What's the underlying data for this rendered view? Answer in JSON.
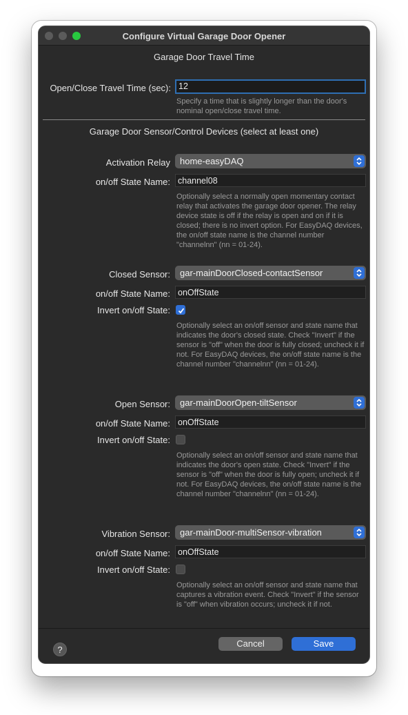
{
  "window": {
    "title": "Configure Virtual Garage Door Opener"
  },
  "travel": {
    "section_title": "Garage Door Travel Time",
    "label": "Open/Close Travel Time (sec):",
    "value": "12",
    "help": "Specify a time that is slightly longer than the door's nominal open/close travel time."
  },
  "devices": {
    "section_title": "Garage Door Sensor/Control Devices (select at least one)"
  },
  "relay": {
    "label": "Activation Relay",
    "device": "home-easyDAQ",
    "state_label": "on/off State Name:",
    "state_value": "channel08",
    "help": "Optionally select a normally open momentary contact relay that activates the garage door opener. The relay device state is off if the relay is open and on if it is closed; there is no invert option.  For EasyDAQ devices, the on/off state name is the channel number \"channelnn\" (nn = 01-24)."
  },
  "closed": {
    "label": "Closed Sensor:",
    "device": "gar-mainDoorClosed-contactSensor",
    "state_label": "on/off State Name:",
    "state_value": "onOffState",
    "invert_label": "Invert on/off State:",
    "invert_checked": true,
    "help": "Optionally select an on/off sensor and state name that indicates the door's closed state.  Check \"Invert\" if the sensor is \"off\" when the door is fully closed; uncheck it if not.  For EasyDAQ devices, the on/off state name is the channel number \"channelnn\" (nn = 01-24)."
  },
  "open": {
    "label": "Open Sensor:",
    "device": "gar-mainDoorOpen-tiltSensor",
    "state_label": "on/off State Name:",
    "state_value": "onOffState",
    "invert_label": "Invert on/off State:",
    "invert_checked": false,
    "help": "Optionally select an on/off sensor and state name that indicates the door's open state.  Check \"Invert\" if the sensor is \"off\" when the door is fully open; uncheck it if not.  For EasyDAQ devices, the on/off state name is the channel number \"channelnn\" (nn = 01-24)."
  },
  "vibration": {
    "label": "Vibration Sensor:",
    "device": "gar-mainDoor-multiSensor-vibration",
    "state_label": "on/off State Name:",
    "state_value": "onOffState",
    "invert_label": "Invert on/off State:",
    "invert_checked": false,
    "help": "Optionally select an on/off sensor and state name that captures a vibration event.  Check \"Invert\" if the sensor is \"off\" when vibration occurs; uncheck it if not."
  },
  "footer": {
    "help_symbol": "?",
    "cancel_label": "Cancel",
    "save_label": "Save"
  },
  "colors": {
    "accent": "#2f6fd6",
    "window_bg": "#2a2a2a",
    "zoom_light": "#28c840"
  }
}
